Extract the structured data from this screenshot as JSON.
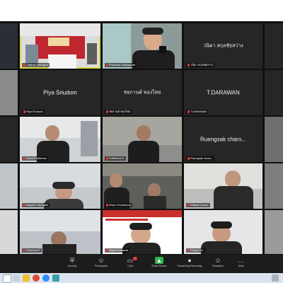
{
  "meeting": {
    "participants": [
      {
        "id": "p1",
        "label": "Thitima Saengruk",
        "mode": "video"
      },
      {
        "id": "p2",
        "label": "Pornchai Chaiyaphat",
        "mode": "video"
      },
      {
        "id": "p3",
        "label": "วนิดา สกุลชัยสว่าง",
        "mode": "name"
      },
      {
        "id": "p4",
        "label": "Piya Sriudom",
        "mode": "name"
      },
      {
        "id": "p5",
        "label": "ชยกานต์ ทองไทย",
        "mode": "name"
      },
      {
        "id": "p6",
        "label": "T.DARAWAN",
        "mode": "name"
      },
      {
        "id": "p7",
        "label": "Sawit Puttachan",
        "mode": "video"
      },
      {
        "id": "p8",
        "label": "Sutthichai K.",
        "mode": "video"
      },
      {
        "id": "p9",
        "label": "Ruengsak charo...",
        "mode": "name"
      },
      {
        "id": "p10",
        "label": "Jiraporn Wonglee",
        "mode": "video"
      },
      {
        "id": "p11",
        "label": "Wirat Chuaiudom",
        "mode": "video"
      },
      {
        "id": "p12",
        "label": "Kittisak Sanoe",
        "mode": "video"
      },
      {
        "id": "p13",
        "label": "Somchai P.",
        "mode": "video"
      },
      {
        "id": "p14",
        "label": "Napat Srisawat",
        "mode": "video"
      },
      {
        "id": "p15",
        "label": "Prasert W.",
        "mode": "video"
      }
    ],
    "visible_names": {
      "p4": "Piya Sriudom",
      "p6": "T.DARAWAN",
      "p9": "Ruengsak  charo..."
    },
    "controls": [
      {
        "key": "security",
        "label": "Security",
        "icon": "shield-icon",
        "glyph": "⛨"
      },
      {
        "key": "participants",
        "label": "Participants",
        "icon": "participants-icon",
        "glyph": "☺"
      },
      {
        "key": "chat",
        "label": "Chat",
        "icon": "chat-icon",
        "glyph": "▭",
        "badge": "1"
      },
      {
        "key": "share",
        "label": "Share Screen",
        "icon": "share-screen-icon",
        "glyph": "▲"
      },
      {
        "key": "record",
        "label": "Pause/Stop Recording",
        "icon": "record-icon",
        "glyph": "●"
      },
      {
        "key": "reactions",
        "label": "Reactions",
        "icon": "reactions-icon",
        "glyph": "☺"
      },
      {
        "key": "more",
        "label": "More",
        "icon": "more-icon",
        "glyph": "…"
      }
    ],
    "colors": {
      "accent_active": "#d9d94a",
      "share_green": "#2fb44d",
      "muted_red": "#e23b3b",
      "taskbar": "#dbe4ee"
    }
  }
}
